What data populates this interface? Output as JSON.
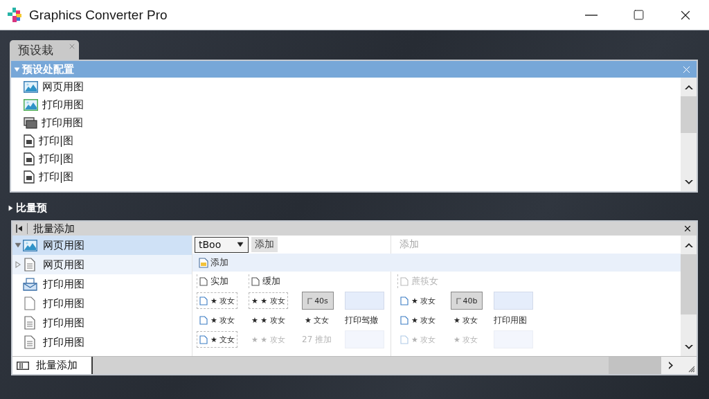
{
  "window": {
    "title": "Graphics Converter Pro"
  },
  "tabs": [
    {
      "label": "预设栽",
      "selected": true
    }
  ],
  "preset_panel": {
    "title": "预设处配置",
    "expanded": true,
    "items": [
      {
        "label": "网页用图",
        "kind": "picture"
      },
      {
        "label": "打印用图",
        "kind": "picture-alt"
      },
      {
        "label": "打印用图",
        "kind": "stack"
      },
      {
        "label": "打印|图",
        "kind": "document"
      },
      {
        "label": "打印|图",
        "kind": "document"
      },
      {
        "label": "打印|图",
        "kind": "document"
      }
    ]
  },
  "batch_section": {
    "label": "比量预",
    "expanded": false
  },
  "batch_panel": {
    "title": "批量添加",
    "tree": [
      {
        "label": "网页用图",
        "kind": "picture",
        "expandable": true,
        "expanded": true,
        "selected": true,
        "hovered": false
      },
      {
        "label": "网页用图",
        "kind": "lined-document",
        "expandable": true,
        "expanded": false,
        "selected": false,
        "hovered": true
      },
      {
        "label": "打印用图",
        "kind": "tray",
        "expandable": false,
        "selected": false,
        "hovered": false
      },
      {
        "label": "打印用图",
        "kind": "page",
        "expandable": false,
        "selected": false,
        "hovered": false
      },
      {
        "label": "打印用图",
        "kind": "lined-document",
        "expandable": false,
        "selected": false,
        "hovered": false
      },
      {
        "label": "打印用图",
        "kind": "lined-document",
        "expandable": false,
        "selected": false,
        "hovered": false
      }
    ],
    "toolbar": {
      "dropdown_value": "tBoo",
      "add_button": "添加",
      "secondary_button": {
        "label": "添加",
        "disabled": true
      }
    },
    "action_bar": {
      "label": "添加"
    },
    "grid_left": [
      [
        {
          "kind": "label",
          "text": "实加",
          "disabled": false
        },
        {
          "kind": "label",
          "text": "缓加",
          "disabled": false
        }
      ],
      [
        {
          "kind": "file-entry",
          "text": "★ 攻女",
          "framed": true,
          "disabled": false
        },
        {
          "kind": "entry",
          "text": "★ ★ 攻女",
          "framed": true,
          "disabled": false
        },
        {
          "kind": "thumb",
          "text": "40s",
          "disabled": false
        },
        {
          "kind": "swatch",
          "disabled": false
        }
      ],
      [
        {
          "kind": "file-entry",
          "text": "★ 攻女",
          "framed": false,
          "disabled": false
        },
        {
          "kind": "entry",
          "text": "★ ★ 攻女",
          "framed": false,
          "disabled": false
        },
        {
          "kind": "entry",
          "text": "★ 文女",
          "framed": false,
          "disabled": false
        },
        {
          "kind": "caption",
          "text": "打印驾撤",
          "disabled": false
        }
      ],
      [
        {
          "kind": "file-entry",
          "text": "★ 文女",
          "framed": true,
          "disabled": false
        },
        {
          "kind": "entry",
          "text": "★ ★ 攻女",
          "framed": false,
          "disabled": true
        },
        {
          "kind": "caption",
          "text": "27 推加",
          "disabled": true
        },
        {
          "kind": "swatch",
          "disabled": true
        }
      ]
    ],
    "grid_right": [
      [
        {
          "kind": "label",
          "text": "蔗筷女",
          "disabled": true
        }
      ],
      [
        {
          "kind": "file-entry",
          "text": "★ 攻女",
          "framed": false,
          "disabled": false
        },
        {
          "kind": "thumb",
          "text": "40b",
          "disabled": false
        },
        {
          "kind": "swatch",
          "disabled": false
        }
      ],
      [
        {
          "kind": "file-entry",
          "text": "★ 攻女",
          "framed": false,
          "disabled": false
        },
        {
          "kind": "entry",
          "text": "★ 攻女",
          "framed": false,
          "disabled": false
        },
        {
          "kind": "caption",
          "text": "打印用图",
          "disabled": false
        }
      ],
      [
        {
          "kind": "file-entry",
          "text": "★ 攻女",
          "framed": false,
          "disabled": true
        },
        {
          "kind": "entry",
          "text": "★ 攻女",
          "framed": false,
          "disabled": true
        },
        {
          "kind": "swatch",
          "disabled": true
        }
      ]
    ]
  },
  "bottom_tab": {
    "label": "批量添加",
    "selected": true
  }
}
